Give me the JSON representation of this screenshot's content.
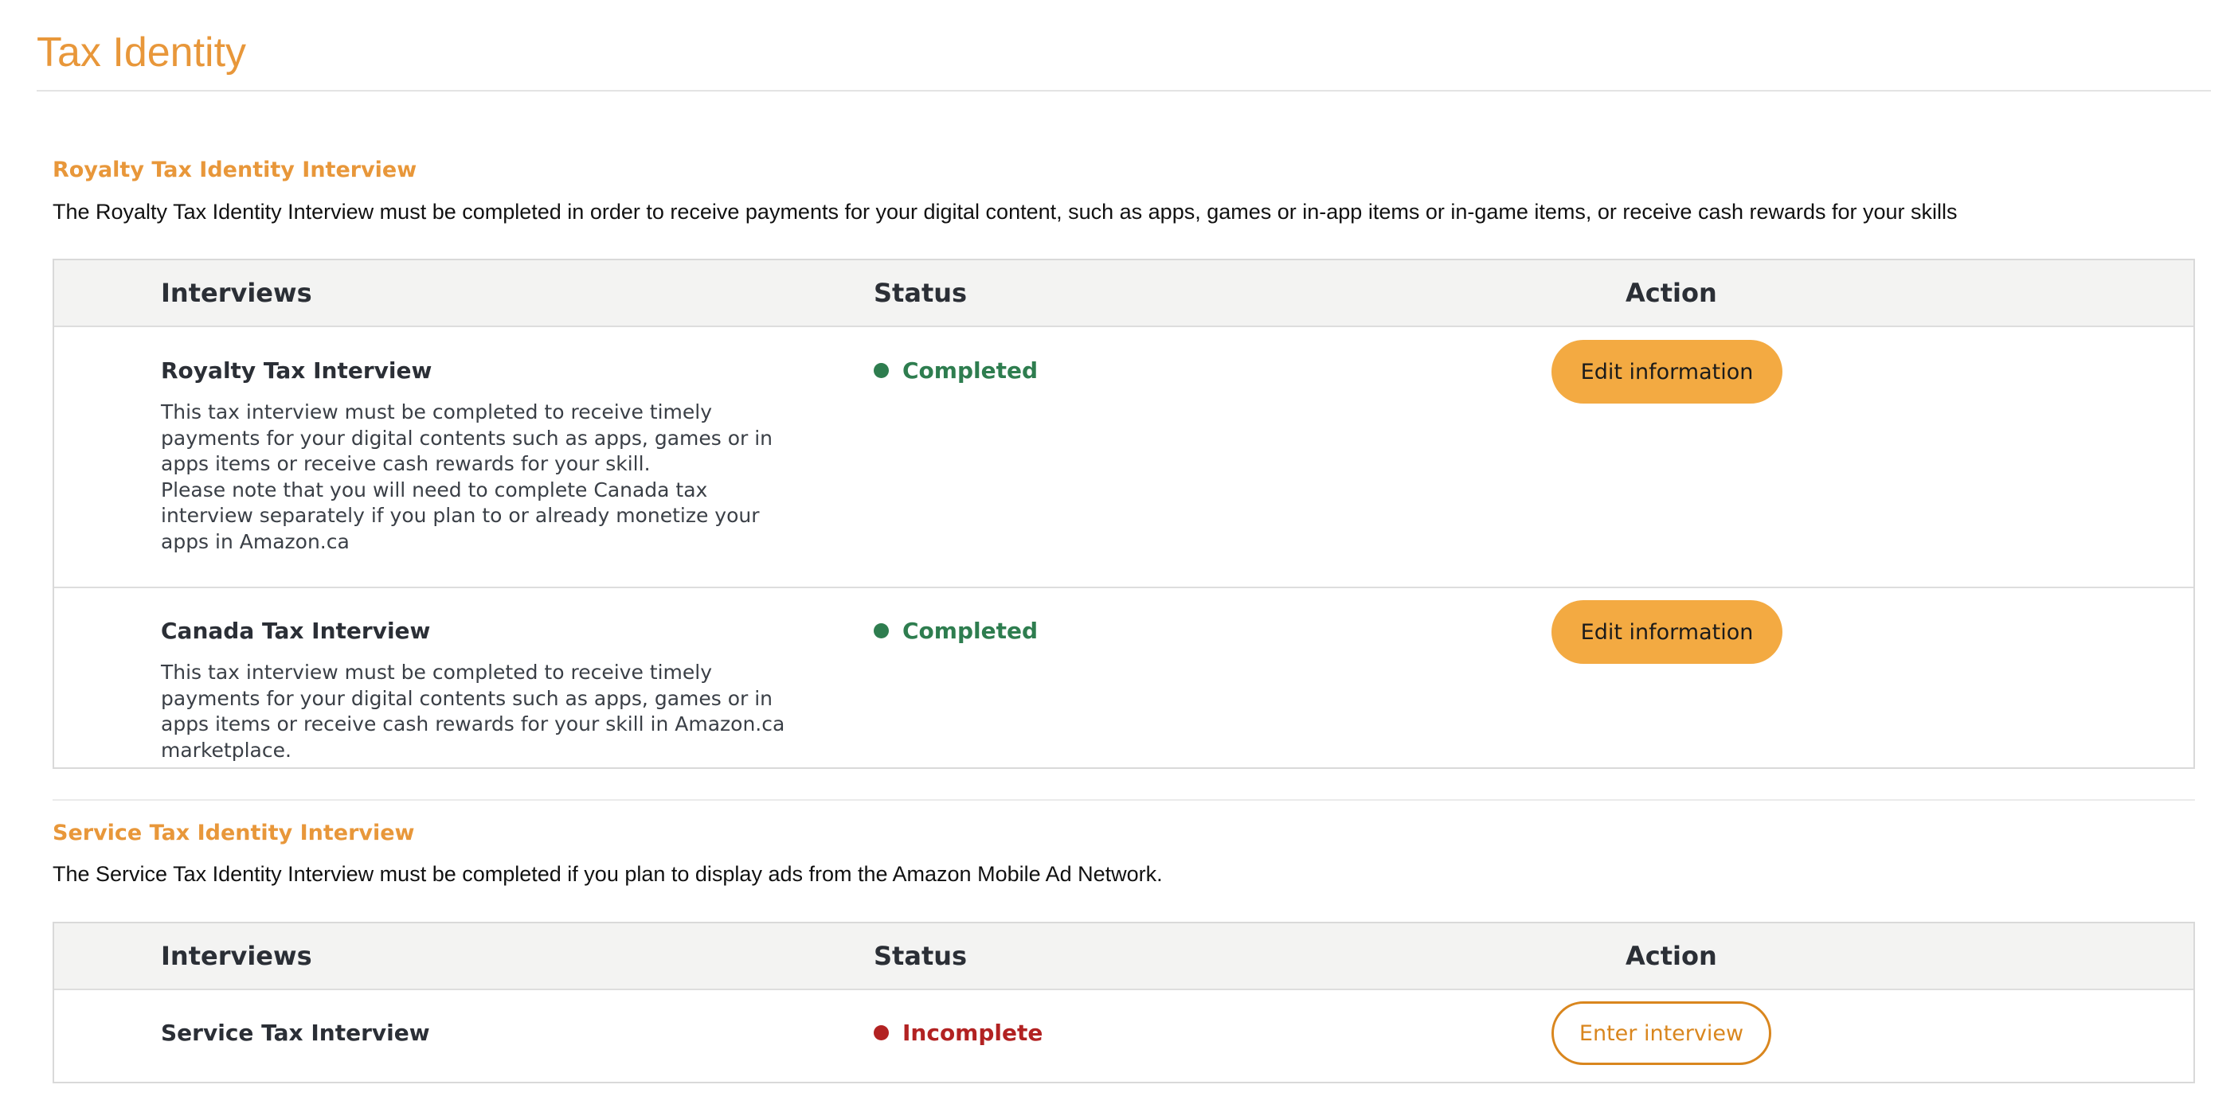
{
  "page": {
    "title": "Tax Identity"
  },
  "colors": {
    "accent": "#E8973A",
    "button_fill": "#F3AA42",
    "completed": "#2E7D4F",
    "incomplete": "#B22222"
  },
  "sections": [
    {
      "heading": "Royalty Tax Identity Interview",
      "description": "The Royalty Tax Identity Interview must be completed in order to receive payments for your digital content, such as apps, games or in-app items or in-game items, or receive cash rewards for your skills",
      "columns": {
        "interviews": "Interviews",
        "status": "Status",
        "action": "Action"
      },
      "rows": [
        {
          "title": "Royalty Tax Interview",
          "description": "This tax interview must be completed to receive timely payments for your digital contents such as apps, games or in apps items or receive cash rewards for your skill.\nPlease note that you will need to complete Canada tax interview separately if you plan to or already monetize your apps in Amazon.ca",
          "status": "Completed",
          "status_icon": "green-dot-icon",
          "action": "Edit information"
        },
        {
          "title": "Canada Tax Interview",
          "description": "This tax interview must be completed to receive timely payments for your digital contents such as apps, games or in apps items or receive cash rewards for your skill in Amazon.ca marketplace.",
          "status": "Completed",
          "status_icon": "green-dot-icon",
          "action": "Edit information"
        }
      ]
    },
    {
      "heading": "Service Tax Identity Interview",
      "description": "The Service Tax Identity Interview must be completed if you plan to display ads from the Amazon Mobile Ad Network.",
      "columns": {
        "interviews": "Interviews",
        "status": "Status",
        "action": "Action"
      },
      "rows": [
        {
          "title": "Service Tax Interview",
          "status": "Incomplete",
          "status_icon": "red-dot-icon",
          "action": "Enter interview"
        }
      ]
    }
  ]
}
